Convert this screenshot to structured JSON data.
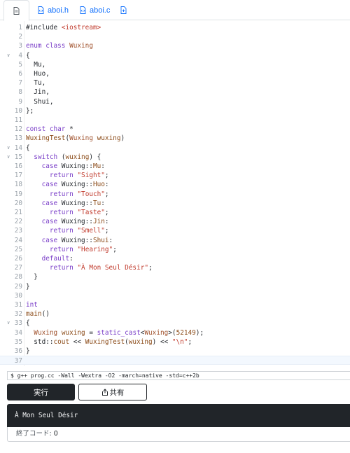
{
  "tabs": [
    {
      "label": "",
      "icon": "file-icon",
      "active": true
    },
    {
      "label": "aboi.h",
      "icon": "file-code-icon"
    },
    {
      "label": "aboi.c",
      "icon": "file-code-icon"
    },
    {
      "label": "",
      "icon": "file-plus-icon"
    }
  ],
  "editor": {
    "current_line": 37,
    "lines": [
      {
        "n": "1",
        "fold": "",
        "html": "#include <span class='inc'>&lt;iostream&gt;</span>"
      },
      {
        "n": "2",
        "fold": "",
        "html": ""
      },
      {
        "n": "3",
        "fold": "",
        "html": "<span class='kw'>enum class</span> <span class='ty'>Wuxing</span>"
      },
      {
        "n": "4",
        "fold": "v",
        "html": "{"
      },
      {
        "n": "5",
        "fold": "",
        "html": "  Mu,"
      },
      {
        "n": "6",
        "fold": "",
        "html": "  Huo,"
      },
      {
        "n": "7",
        "fold": "",
        "html": "  Tu,"
      },
      {
        "n": "8",
        "fold": "",
        "html": "  Jin,"
      },
      {
        "n": "9",
        "fold": "",
        "html": "  Shui,"
      },
      {
        "n": "10",
        "fold": "",
        "html": "};"
      },
      {
        "n": "11",
        "fold": "",
        "html": ""
      },
      {
        "n": "12",
        "fold": "",
        "html": "<span class='kw'>const char</span> *"
      },
      {
        "n": "13",
        "fold": "",
        "html": "<span class='fn'>WuxingTest</span>(<span class='ty'>Wuxing</span> <span class='fn'>wuxing</span>)"
      },
      {
        "n": "14",
        "fold": "v",
        "html": "{"
      },
      {
        "n": "15",
        "fold": "v",
        "html": "  <span class='kw'>switch</span> (<span class='fn'>wuxing</span>) {"
      },
      {
        "n": "16",
        "fold": "",
        "html": "    <span class='kw'>case</span> Wuxing::<span class='fn'>Mu</span>:"
      },
      {
        "n": "17",
        "fold": "",
        "html": "      <span class='kw'>return</span> <span class='st'>\"Sight\"</span>;"
      },
      {
        "n": "18",
        "fold": "",
        "html": "    <span class='kw'>case</span> Wuxing::<span class='fn'>Huo</span>:"
      },
      {
        "n": "19",
        "fold": "",
        "html": "      <span class='kw'>return</span> <span class='st'>\"Touch\"</span>;"
      },
      {
        "n": "20",
        "fold": "",
        "html": "    <span class='kw'>case</span> Wuxing::<span class='fn'>Tu</span>:"
      },
      {
        "n": "21",
        "fold": "",
        "html": "      <span class='kw'>return</span> <span class='st'>\"Taste\"</span>;"
      },
      {
        "n": "22",
        "fold": "",
        "html": "    <span class='kw'>case</span> Wuxing::<span class='fn'>Jin</span>:"
      },
      {
        "n": "23",
        "fold": "",
        "html": "      <span class='kw'>return</span> <span class='st'>\"Smell\"</span>;"
      },
      {
        "n": "24",
        "fold": "",
        "html": "    <span class='kw'>case</span> Wuxing::<span class='fn'>Shui</span>:"
      },
      {
        "n": "25",
        "fold": "",
        "html": "      <span class='kw'>return</span> <span class='st'>\"Hearing\"</span>;"
      },
      {
        "n": "26",
        "fold": "",
        "html": "    <span class='kw'>default</span>:"
      },
      {
        "n": "27",
        "fold": "",
        "html": "      <span class='kw'>return</span> <span class='st'>\"À Mon Seul Désir\"</span>;"
      },
      {
        "n": "28",
        "fold": "",
        "html": "  }"
      },
      {
        "n": "29",
        "fold": "",
        "html": "}"
      },
      {
        "n": "30",
        "fold": "",
        "html": ""
      },
      {
        "n": "31",
        "fold": "",
        "html": "<span class='kw'>int</span>"
      },
      {
        "n": "32",
        "fold": "",
        "html": "<span class='fn'>main</span>()"
      },
      {
        "n": "33",
        "fold": "v",
        "html": "{"
      },
      {
        "n": "34",
        "fold": "",
        "html": "  <span class='ty'>Wuxing</span> <span class='fn'>wuxing</span> = <span class='kw'>static_cast</span>&lt;<span class='ty'>Wuxing</span>&gt;(<span class='nm'>52149</span>);"
      },
      {
        "n": "35",
        "fold": "",
        "html": "  std::<span class='fn'>cout</span> &lt;&lt; <span class='fn'>WuxingTest</span>(<span class='fn'>wuxing</span>) &lt;&lt; <span class='st'>\"\\n\"</span>;"
      },
      {
        "n": "36",
        "fold": "",
        "html": "}"
      },
      {
        "n": "37",
        "fold": "",
        "html": ""
      }
    ]
  },
  "command": "$ g++ prog.cc -Wall -Wextra -O2 -march=native -std=c++2b",
  "run_label": "実行",
  "share_label": "共有",
  "output_text": "À Mon Seul Désir",
  "exit_label": "終了コード:",
  "exit_value": "0"
}
